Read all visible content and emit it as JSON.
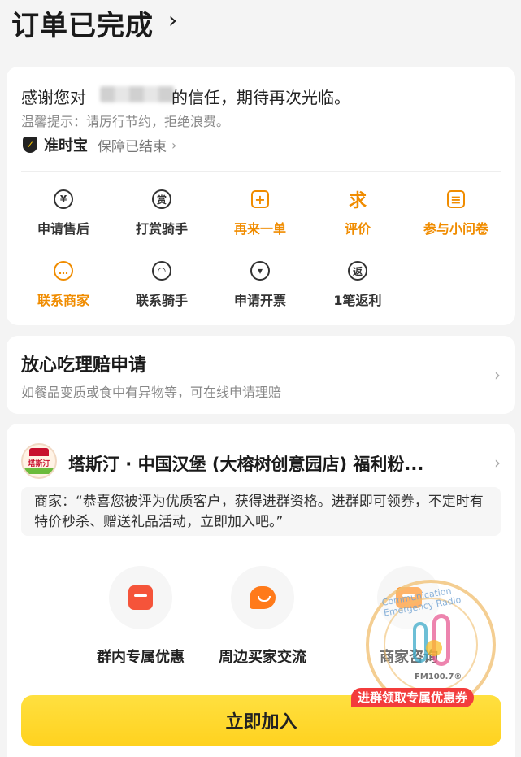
{
  "header": {
    "title": "订单已完成",
    "chevron": "›"
  },
  "thanks": {
    "prefix": "感谢您对",
    "suffix": "的信任，期待再次光临。",
    "tip": "温馨提示：请厉行节约，拒绝浪费。"
  },
  "guarantee": {
    "name": "准时宝",
    "status": "保障已结束",
    "chevron": "›"
  },
  "actions": [
    {
      "label": "申请售后",
      "icon": "yuan-refund-icon",
      "glyph": "¥"
    },
    {
      "label": "打赏骑手",
      "icon": "reward-icon",
      "glyph": "赏"
    },
    {
      "label": "再来一单",
      "icon": "reorder-icon",
      "glyph": "+"
    },
    {
      "label": "评价",
      "icon": "review-icon",
      "glyph": "求"
    },
    {
      "label": "参与小问卷",
      "icon": "survey-icon",
      "glyph": "≡"
    },
    {
      "label": "联系商家",
      "icon": "contact-merchant-icon",
      "glyph": "…"
    },
    {
      "label": "联系骑手",
      "icon": "contact-rider-icon",
      "glyph": "◠"
    },
    {
      "label": "申请开票",
      "icon": "invoice-icon",
      "glyph": "▾"
    },
    {
      "label": "1笔返利",
      "icon": "rebate-icon",
      "glyph": "返"
    }
  ],
  "claim": {
    "title": "放心吃理赔申请",
    "subtitle": "如餐品变质或食中有异物等，可在线申请理赔",
    "chevron": "›"
  },
  "shop": {
    "logo_text": "塔斯汀",
    "name": "塔斯汀 · 中国汉堡 (大榕树创意园店) 福利粉...",
    "chevron": "›",
    "quote": "商家：“恭喜您被评为优质客户，获得进群资格。进群即可领券，不定时有特价秒杀、赠送礼品活动，立即加入吧。”"
  },
  "features": [
    {
      "label": "群内专属优惠",
      "icon": "group-coupon-icon"
    },
    {
      "label": "周边买家交流",
      "icon": "chat-bubble-icon"
    },
    {
      "label": "商家咨询",
      "icon": "merchant-consult-icon"
    }
  ],
  "watermark": {
    "ring_text": "Communication Emergency Radio",
    "fm": "FM100.7®"
  },
  "promo": "进群领取专属优惠券",
  "join_button": "立即加入",
  "colors": {
    "accent_orange": "#f08c00",
    "button_yellow": "#ffd21f",
    "promo_red": "#f33c3c"
  }
}
